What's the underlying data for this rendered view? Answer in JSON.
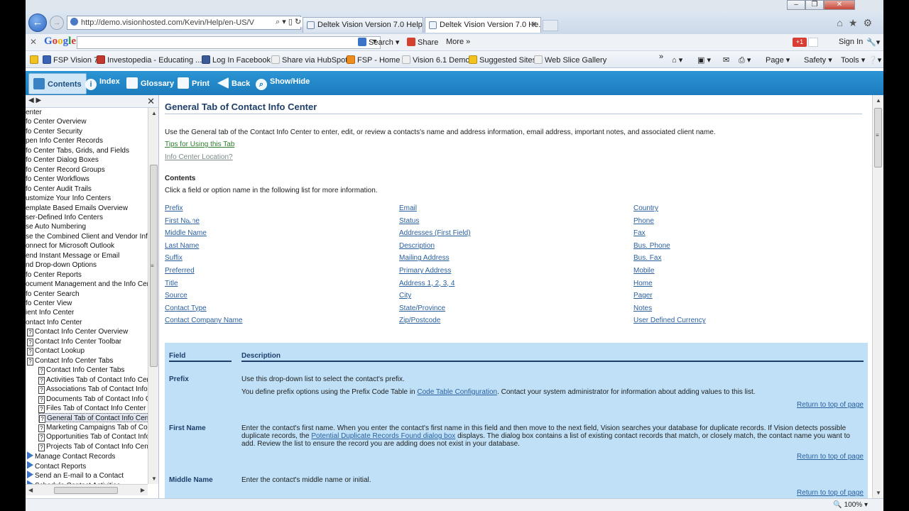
{
  "browser": {
    "address_url": "http://demo.visionhosted.com/Kevin/Help/en-US/V",
    "tabs": [
      {
        "label": "Deltek Vision Version 7.0 Help ..."
      },
      {
        "label": "Deltek Vision Version 7.0 He..."
      }
    ],
    "zoom": "100%"
  },
  "google_toolbar": {
    "search_label": "Search",
    "share_label": "Share",
    "more_label": "More",
    "signin_label": "Sign In",
    "plus_one": "+1"
  },
  "favorites": [
    {
      "label": "FSP Vision 7",
      "color": "#3a62b5"
    },
    {
      "label": "Investopedia - Educating ...",
      "color": "#c2372e"
    },
    {
      "label": "Log In  Facebook",
      "color": "#3b5998"
    },
    {
      "label": "Share via HubSpot",
      "color": "#f0f0f0"
    },
    {
      "label": "FSP - Home",
      "color": "#f08c1c"
    },
    {
      "label": "Vision 6.1 Demo",
      "color": "#f0f0f0"
    },
    {
      "label": "Suggested Sites",
      "color": "#f2c21e"
    },
    {
      "label": "Web Slice Gallery",
      "color": "#f0f0f0"
    }
  ],
  "command_bar": {
    "page_label": "Page",
    "safety_label": "Safety",
    "tools_label": "Tools"
  },
  "help_toolbar": {
    "contents": "Contents",
    "index": "Index",
    "glossary": "Glossary",
    "print": "Print",
    "back": "Back",
    "show_hide": "Show/Hide"
  },
  "toc": {
    "items": [
      {
        "label": "enter",
        "icon": "none",
        "indent": 0
      },
      {
        "label": "fo Center Overview",
        "icon": "none",
        "indent": 0
      },
      {
        "label": "fo Center Security",
        "icon": "none",
        "indent": 0
      },
      {
        "label": "pen Info Center Records",
        "icon": "none",
        "indent": 0
      },
      {
        "label": "fo Center Tabs, Grids, and Fields",
        "icon": "none",
        "indent": 0
      },
      {
        "label": "fo Center Dialog Boxes",
        "icon": "none",
        "indent": 0
      },
      {
        "label": "fo Center Record Groups",
        "icon": "none",
        "indent": 0
      },
      {
        "label": "fo Center Workflows",
        "icon": "none",
        "indent": 0
      },
      {
        "label": "fo Center Audit Trails",
        "icon": "none",
        "indent": 0
      },
      {
        "label": "ustomize Your Info Centers",
        "icon": "none",
        "indent": 0
      },
      {
        "label": "emplate Based Emails Overview",
        "icon": "none",
        "indent": 0
      },
      {
        "label": "ser-Defined Info Centers",
        "icon": "none",
        "indent": 0
      },
      {
        "label": "se Auto Numbering",
        "icon": "none",
        "indent": 0
      },
      {
        "label": "se the Combined Client and Vendor Info Ce",
        "icon": "none",
        "indent": 0
      },
      {
        "label": "onnect for Microsoft Outlook",
        "icon": "none",
        "indent": 0
      },
      {
        "label": "end Instant Message or Email",
        "icon": "none",
        "indent": 0
      },
      {
        "label": "nd Drop-down Options",
        "icon": "none",
        "indent": 0
      },
      {
        "label": "fo Center Reports",
        "icon": "none",
        "indent": 0
      },
      {
        "label": "ocument Management and the Info Center",
        "icon": "none",
        "indent": 0
      },
      {
        "label": "fo Center Search",
        "icon": "none",
        "indent": 0
      },
      {
        "label": "fo Center View",
        "icon": "none",
        "indent": 0
      },
      {
        "label": "ient Info Center",
        "icon": "none",
        "indent": 0
      },
      {
        "label": "ontact Info Center",
        "icon": "none",
        "indent": 0
      },
      {
        "label": "Contact Info Center Overview",
        "icon": "q",
        "indent": 1
      },
      {
        "label": "Contact Info Center Toolbar",
        "icon": "q",
        "indent": 1
      },
      {
        "label": "Contact Lookup",
        "icon": "q",
        "indent": 1
      },
      {
        "label": "Contact Info Center Tabs",
        "icon": "q",
        "indent": 1
      },
      {
        "label": "Contact Info Center Tabs",
        "icon": "q",
        "indent": 2
      },
      {
        "label": "Activities Tab of Contact Info Cente",
        "icon": "q",
        "indent": 2
      },
      {
        "label": "Associations Tab of Contact Info Ce",
        "icon": "q",
        "indent": 2
      },
      {
        "label": "Documents Tab of Contact Info Cer",
        "icon": "q",
        "indent": 2
      },
      {
        "label": "Files Tab of Contact Info Center",
        "icon": "q",
        "indent": 2
      },
      {
        "label": "General Tab of Contact Info Center",
        "icon": "q",
        "indent": 2,
        "selected": true
      },
      {
        "label": "Marketing Campaigns Tab of Contac",
        "icon": "q",
        "indent": 2
      },
      {
        "label": "Opportunities Tab of Contact Info C",
        "icon": "q",
        "indent": 2
      },
      {
        "label": "Projects Tab of Contact Info Center",
        "icon": "q",
        "indent": 2
      },
      {
        "label": "Manage Contact Records",
        "icon": "book",
        "indent": 1
      },
      {
        "label": "Contact Reports",
        "icon": "book",
        "indent": 1
      },
      {
        "label": "Send an E-mail to a Contact",
        "icon": "book",
        "indent": 1
      },
      {
        "label": "Schedule Contact Activities",
        "icon": "book",
        "indent": 1
      }
    ]
  },
  "content": {
    "title": "General Tab of Contact Info Center",
    "intro": "Use the General tab of the Contact Info Center to enter, edit, or review a contacts's name and address information, email address, important notes, and associated client name.",
    "tips_link": "Tips for Using this Tab",
    "location_link": "Info Center Location?",
    "contents_heading": "Contents",
    "click_note": "Click a field or option name in the following list for more information.",
    "field_columns": [
      [
        "Prefix",
        "First Name",
        "Middle Name",
        "Last Name",
        "Suffix",
        "Preferred",
        "Title",
        "Source",
        "Contact Type",
        "Contact Company Name"
      ],
      [
        "Email",
        "Status",
        "Addresses (First Field)",
        "Description",
        "Mailing Address",
        "Primary Address",
        "Address 1, 2, 3, 4",
        "City",
        "State/Province",
        "Zip/Postcode"
      ],
      [
        "Country",
        "Phone",
        "Fax",
        "Bus. Phone",
        "Bus. Fax",
        "Mobile",
        "Home",
        "Pager",
        "Notes",
        "User Defined Currency"
      ]
    ],
    "table": {
      "col_field": "Field",
      "col_description": "Description",
      "return_label": "Return to top of page",
      "rows": [
        {
          "field": "Prefix",
          "line1": "Use this drop-down list to select the contact's prefix.",
          "line2_pre": "You define prefix options using the Prefix Code Table in ",
          "line2_link": "Code Table Configuration",
          "line2_post": ". Contact your system administrator for information about adding values to this list."
        },
        {
          "field": "First Name",
          "text_pre": "Enter the contact's first name. When you enter the contact's first name in this field and then move to the next field, Vision searches your database for duplicate records. If Vision detects possible duplicate records, the ",
          "text_link": "Potential Duplicate Records Found dialog box",
          "text_post": " displays. The dialog box contains a list of existing contact records that match, or closely match, the contact name you want to add. Review the list to ensure the record you are adding does not exist in your database."
        },
        {
          "field": "Middle Name",
          "text": "Enter the contact's middle name or initial."
        }
      ]
    }
  }
}
